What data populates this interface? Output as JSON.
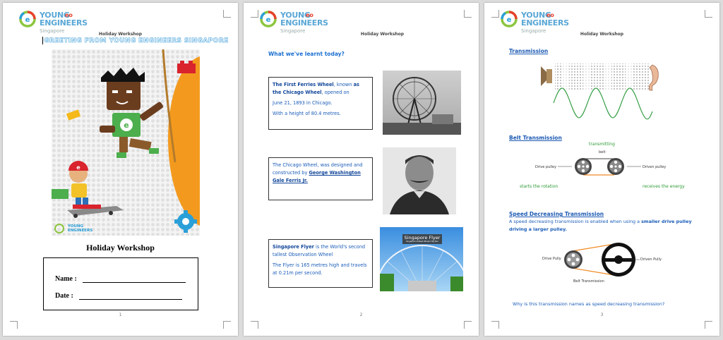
{
  "logo": {
    "line1": "YOUNG",
    "line2": "ENGINEERS",
    "line3": "Singapore",
    "eo": "eo"
  },
  "header": "Holiday Workshop",
  "page1": {
    "greeting": "GREETING FROM YOUNG ENGINEERS SINGAPORE",
    "cover_logo": "YOUNG ENGINEERS",
    "title": "Holiday Workshop",
    "name_label": "Name :",
    "date_label": "Date   :",
    "page_number": "1"
  },
  "page2": {
    "question": "What we've learnt today?",
    "box1": {
      "b1": "The First Ferries Wheel",
      "t1": ", known ",
      "b2": "as the Chicago Wheel",
      "t2": ", opened on",
      "line2": "June 21, 1893 in Chicago.",
      "line3": "With a height of 80.4 metres."
    },
    "box2": {
      "t1": "The Chicago Wheel, was designed and constructed by ",
      "u1": "George Washington Gale Ferris Jr."
    },
    "box3": {
      "b1": "Singapore Flyer",
      "t1": " is the World's second tallest Observation Wheel",
      "line2": "The Flyer is 165 metres high and travels at 0.21m per second."
    },
    "photo_sign": "Singapore Flyer",
    "photo_sign_sub": "Singapore's tallest Wheel's Sky Bar",
    "page_number": "2"
  },
  "page3": {
    "transmission_title": "Transmission",
    "belt_title": "Belt Transmission",
    "belt_labels": {
      "transmitting": "transmitting",
      "belt": "belt",
      "drive": "Drive pulley",
      "driven": "Driven pulley",
      "starts": "starts the rotation",
      "receives": "receives the energy"
    },
    "speed_title": "Speed Decreasing Transmission",
    "speed_t1": "A speed decreasing transmission is enabled when using a ",
    "speed_b1": "smaller drive pulley driving a larger pulley.",
    "speed_labels": {
      "drive": "Drive Pully",
      "driven": "Driven Pully",
      "belt": "Belt Transmission"
    },
    "question": "Why is this transmission names as speed decreasing transmission?",
    "page_number": "3"
  },
  "colors": {
    "accent_blue": "#1b5db8",
    "green": "#2e9b36",
    "logo_blue": "#5aa7d6"
  }
}
